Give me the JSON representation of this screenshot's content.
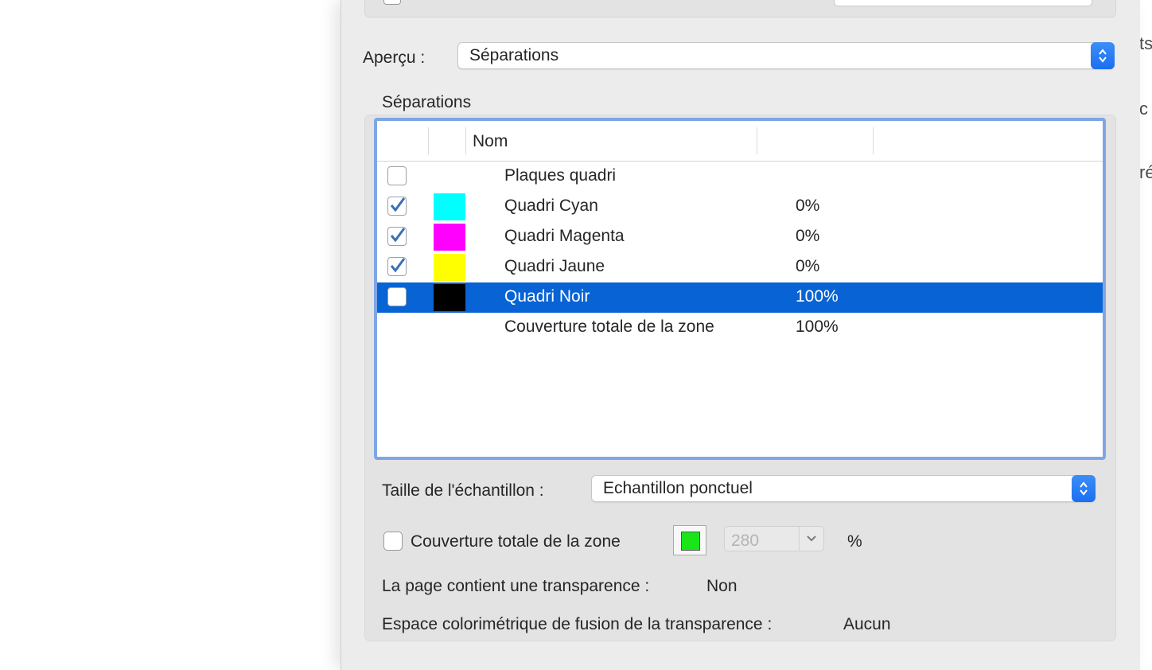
{
  "preview": {
    "label": "Aperçu :",
    "value": "Séparations"
  },
  "separations": {
    "title": "Séparations",
    "columns": {
      "name": "Nom"
    },
    "rows": [
      {
        "name": "Plaques quadri",
        "percent": "",
        "checked": false,
        "color": ""
      },
      {
        "name": "Quadri Cyan",
        "percent": "0%",
        "checked": true,
        "color": "#00ffff"
      },
      {
        "name": "Quadri Magenta",
        "percent": "0%",
        "checked": true,
        "color": "#ff00ff"
      },
      {
        "name": "Quadri Jaune",
        "percent": "0%",
        "checked": true,
        "color": "#ffff00"
      },
      {
        "name": "Quadri Noir",
        "percent": "100%",
        "checked": false,
        "color": "#000000",
        "selected": true
      },
      {
        "name": "Couverture totale de la zone",
        "percent": "100%"
      }
    ]
  },
  "sample": {
    "label": "Taille de l'échantillon :",
    "value": "Echantillon ponctuel"
  },
  "coverage": {
    "label": "Couverture totale de la zone",
    "checked": false,
    "swatch_color": "#19e619",
    "value": "280",
    "unit": "%"
  },
  "transparency": {
    "label": "La page contient une transparence :",
    "value": "Non"
  },
  "blend_space": {
    "label": "Espace colorimétrique de fusion de la transparence :",
    "value": "Aucun"
  },
  "edge_texts": [
    "ts",
    "c",
    "ré"
  ],
  "colors": {
    "accent": "#1b6ff0",
    "selection": "#0863d4",
    "table_focus": "#7ea6e6"
  }
}
